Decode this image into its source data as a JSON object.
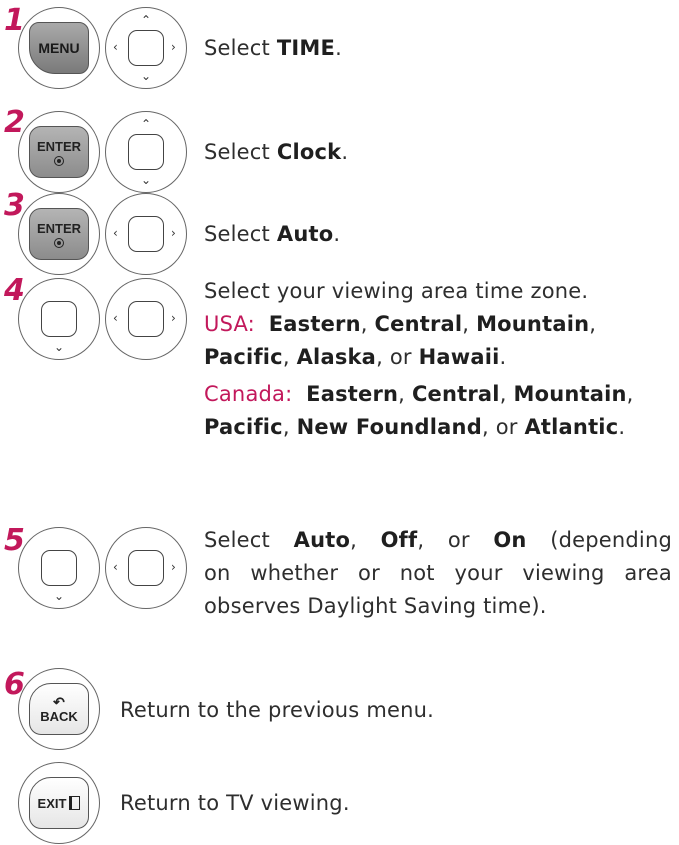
{
  "steps": [
    {
      "number": "1",
      "key_label": "MENU",
      "text": [
        {
          "t": "Select "
        },
        {
          "t": "TIME",
          "b": true
        },
        {
          "t": "."
        }
      ]
    },
    {
      "number": "2",
      "key_label": "ENTER",
      "text": [
        {
          "t": "Select "
        },
        {
          "t": "Clock",
          "b": true
        },
        {
          "t": "."
        }
      ]
    },
    {
      "number": "3",
      "key_label": "ENTER",
      "text": [
        {
          "t": "Select "
        },
        {
          "t": "Auto",
          "b": true
        },
        {
          "t": "."
        }
      ]
    },
    {
      "number": "4",
      "text": [
        {
          "t": "Select your viewing area time zone."
        }
      ],
      "usa_label": "USA:",
      "usa_text": [
        {
          "t": "Eastern",
          "b": true
        },
        {
          "t": ", "
        },
        {
          "t": "Central",
          "b": true
        },
        {
          "t": ", "
        },
        {
          "t": "Mountain",
          "b": true
        },
        {
          "t": ","
        }
      ],
      "usa_text2": [
        {
          "t": "Pacific",
          "b": true
        },
        {
          "t": ", "
        },
        {
          "t": "Alaska",
          "b": true
        },
        {
          "t": ", or "
        },
        {
          "t": "Hawaii",
          "b": true
        },
        {
          "t": "."
        }
      ],
      "canada_label": "Canada:",
      "canada_text": [
        {
          "t": "Eastern",
          "b": true
        },
        {
          "t": ", "
        },
        {
          "t": "Central",
          "b": true
        },
        {
          "t": ", "
        },
        {
          "t": "Mountain",
          "b": true
        },
        {
          "t": ","
        }
      ],
      "canada_text2": [
        {
          "t": "Pacific",
          "b": true
        },
        {
          "t": ", "
        },
        {
          "t": "New Foundland",
          "b": true
        },
        {
          "t": ", or "
        },
        {
          "t": "Atlantic",
          "b": true
        },
        {
          "t": "."
        }
      ]
    },
    {
      "number": "5",
      "lines": [
        [
          {
            "t": "Select "
          },
          {
            "t": "Auto",
            "b": true
          },
          {
            "t": ", "
          },
          {
            "t": "Off",
            "b": true
          },
          {
            "t": ", or "
          },
          {
            "t": "On",
            "b": true
          },
          {
            "t": " (depending"
          }
        ],
        [
          {
            "t": "on whether or not your viewing area"
          }
        ],
        [
          {
            "t": "observes Daylight Saving time)."
          }
        ]
      ]
    },
    {
      "number": "6",
      "key_label": "BACK",
      "text": [
        {
          "t": "Return to the previous menu."
        }
      ]
    },
    {
      "key_label": "EXIT",
      "text": [
        {
          "t": "Return to TV viewing."
        }
      ]
    }
  ],
  "colors": {
    "accent": "#c2185b",
    "text": "#2e2e2e"
  },
  "icons": {
    "nav_up": "chevron-up-icon",
    "nav_down": "chevron-down-icon",
    "nav_left": "chevron-left-icon",
    "nav_right": "chevron-right-icon",
    "back": "back-arrow-icon",
    "exit": "exit-door-icon"
  }
}
